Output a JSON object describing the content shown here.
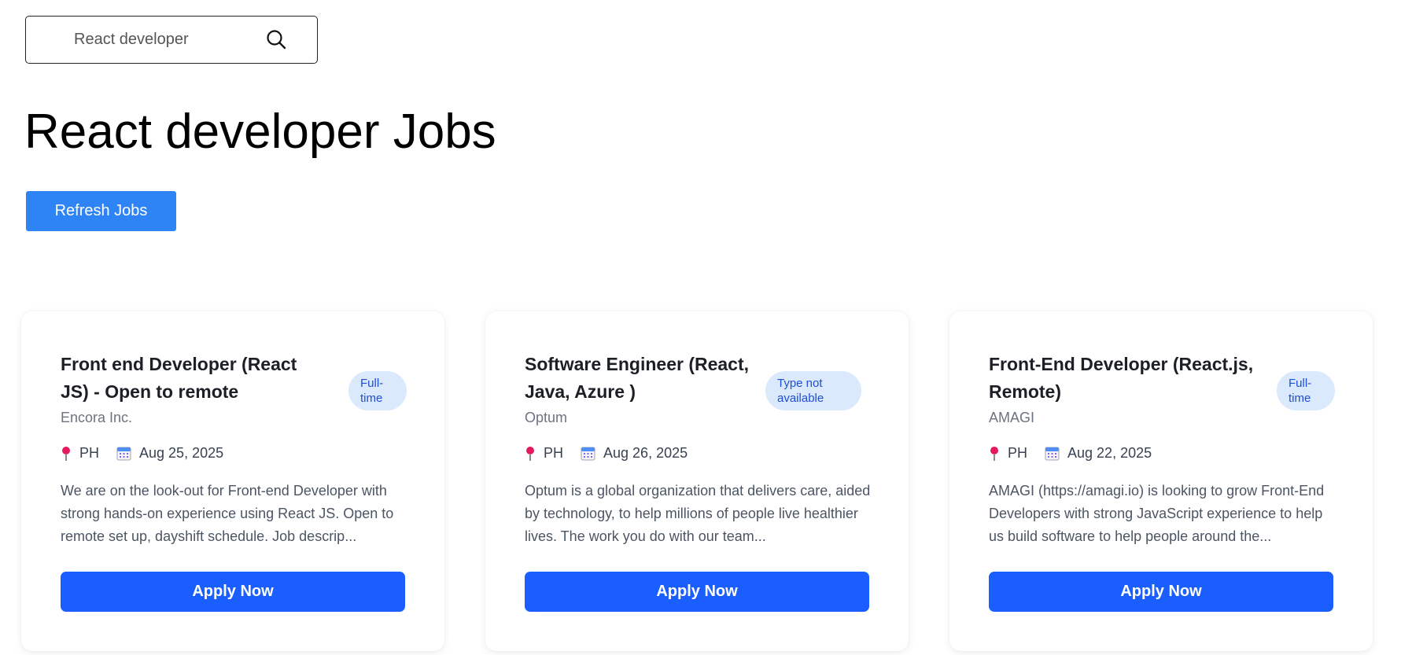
{
  "search": {
    "value": "React developer",
    "placeholder": "React developer"
  },
  "page_title": "React developer Jobs",
  "refresh_label": "Refresh Jobs",
  "icons": {
    "search": "search-icon",
    "location": "location-pin-icon",
    "date": "calendar-icon"
  },
  "colors": {
    "refresh_button": "#2f84f5",
    "apply_button": "#1a5ffe",
    "badge_bg": "#dbe9fd",
    "badge_text": "#1d4ed8"
  },
  "jobs": [
    {
      "title": "Front end Developer (React JS) - Open to remote",
      "type": "Full-time",
      "company": "Encora Inc.",
      "location": "PH",
      "date": "Aug 25, 2025",
      "description": "We are on the look-out for Front-end Developer with strong hands-on experience using React JS. Open to remote set up, dayshift schedule. Job descrip...",
      "apply_label": "Apply Now"
    },
    {
      "title": "Software Engineer (React, Java, Azure )",
      "type": "Type not available",
      "company": "Optum",
      "location": "PH",
      "date": "Aug 26, 2025",
      "description": "Optum is a global organization that delivers care, aided by technology, to help millions of people live healthier lives. The work you do with our team...",
      "apply_label": "Apply Now"
    },
    {
      "title": "Front-End Developer (React.js, Remote)",
      "type": "Full-time",
      "company": "AMAGI",
      "location": "PH",
      "date": "Aug 22, 2025",
      "description": "AMAGI (https://amagi.io) is looking to grow Front-End Developers with strong JavaScript experience to help us build software to help people around the...",
      "apply_label": "Apply Now"
    }
  ]
}
